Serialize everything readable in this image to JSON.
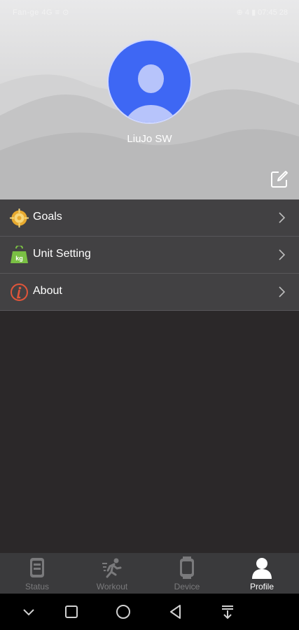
{
  "status_bar": {
    "left_text": "Fan-ge 4G ≡ ⊙",
    "right_text": "⊕ 4 ▮ 07:45 28"
  },
  "profile": {
    "username": "LiuJo SW"
  },
  "menu": {
    "items": [
      {
        "label": "Goals",
        "icon": "goals-icon"
      },
      {
        "label": "Unit Setting",
        "icon": "kg-icon"
      },
      {
        "label": "About",
        "icon": "info-icon"
      }
    ]
  },
  "tabs": [
    {
      "label": "Status",
      "icon": "watch-icon",
      "active": false
    },
    {
      "label": "Workout",
      "icon": "runner-icon",
      "active": false
    },
    {
      "label": "Device",
      "icon": "device-icon",
      "active": false
    },
    {
      "label": "Profile",
      "icon": "person-icon",
      "active": true
    }
  ],
  "colors": {
    "accent_blue": "#3e67f4",
    "menu_bg": "#424143",
    "page_bg": "#2b2829",
    "tabbar_bg": "#3a3a3c"
  }
}
